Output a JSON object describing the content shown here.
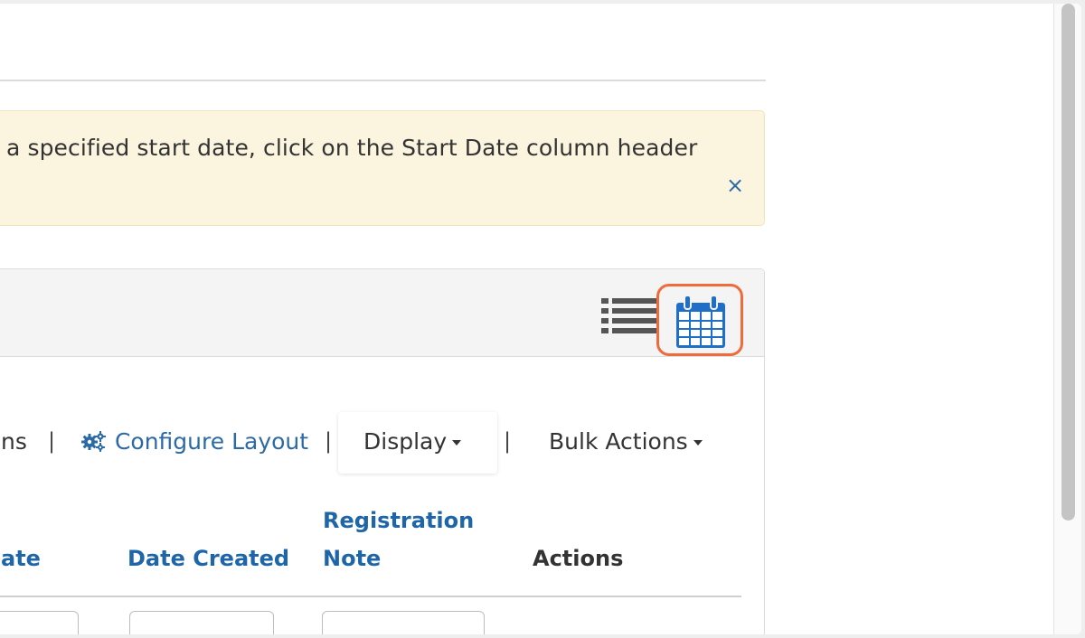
{
  "alert": {
    "message": "a specified start date, click on the Start Date column header",
    "close_glyph": "×"
  },
  "view_toggle": {
    "list_icon": "list-view-icon",
    "calendar_icon": "calendar-icon",
    "highlight_color": "#f06a3a"
  },
  "toolbar": {
    "partial_item": "ns",
    "separator": "|",
    "configure_layout_icon": "gears-icon",
    "configure_layout_label": "Configure Layout",
    "display_label": "Display",
    "bulk_actions_label": "Bulk Actions"
  },
  "table": {
    "columns": [
      {
        "label": "ate",
        "sortable": true
      },
      {
        "label": "Date Created",
        "sortable": true
      },
      {
        "label": "Registration Note",
        "line1": "Registration",
        "line2": "Note",
        "sortable": true
      },
      {
        "label": "Actions",
        "sortable": false
      }
    ]
  },
  "colors": {
    "link": "#2b6aa5",
    "alert_background": "#fbf5df",
    "panel_header": "#f4f4f4"
  }
}
